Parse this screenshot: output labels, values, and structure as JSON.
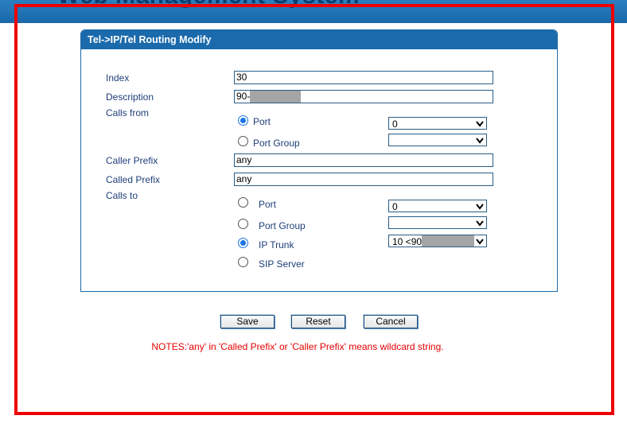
{
  "banner": {
    "title": "Web Management System"
  },
  "panel": {
    "title": "Tel->IP/Tel Routing Modify"
  },
  "form": {
    "index": {
      "label": "Index",
      "value": "30"
    },
    "description": {
      "label": "Description",
      "value": "90-"
    },
    "calls_from": {
      "label": "Calls from",
      "options": [
        {
          "label": "Port",
          "checked": true,
          "select_value": "0"
        },
        {
          "label": "Port Group",
          "checked": false,
          "select_value": ""
        }
      ]
    },
    "caller_prefix": {
      "label": "Caller Prefix",
      "value": "any"
    },
    "called_prefix": {
      "label": "Called Prefix",
      "value": "any"
    },
    "calls_to": {
      "label": "Calls to",
      "options": [
        {
          "label": "Port",
          "checked": false,
          "select_value": "0"
        },
        {
          "label": "Port Group",
          "checked": false,
          "select_value": ""
        },
        {
          "label": "IP Trunk",
          "checked": true,
          "select_value": "10 <90"
        },
        {
          "label": "SIP Server",
          "checked": false
        }
      ]
    }
  },
  "buttons": {
    "save": "Save",
    "reset": "Reset",
    "cancel": "Cancel"
  },
  "notes": "NOTES:'any' in 'Called Prefix' or 'Caller Prefix' means wildcard string.",
  "colors": {
    "accent": "#1a6aac",
    "frame": "#ee0000",
    "notes": "#e60000",
    "radio": "#1a73e8"
  }
}
